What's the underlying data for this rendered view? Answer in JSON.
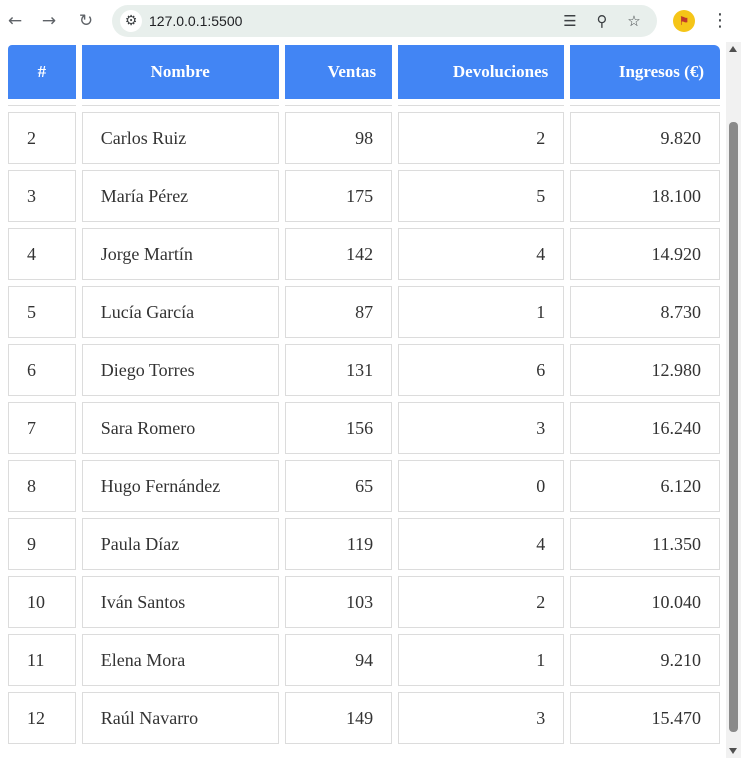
{
  "browser": {
    "url": "127.0.0.1:5500",
    "icons": {
      "back": "arrow-left-icon",
      "forward": "arrow-right-icon",
      "reload": "reload-icon",
      "site_info": "tune-icon",
      "translate": "translate-icon",
      "zoom": "zoom-icon",
      "bookmark": "star-icon",
      "extension": "extension-icon",
      "menu": "kebab-menu-icon"
    }
  },
  "table": {
    "header_color": "#4285f4",
    "columns": [
      "#",
      "Nombre",
      "Ventas",
      "Devoluciones",
      "Ingresos (€)"
    ],
    "rows": [
      {
        "num": "2",
        "name": "Carlos Ruiz",
        "ventas": "98",
        "devoluciones": "2",
        "ingresos": "9.820"
      },
      {
        "num": "3",
        "name": "María Pérez",
        "ventas": "175",
        "devoluciones": "5",
        "ingresos": "18.100"
      },
      {
        "num": "4",
        "name": "Jorge Martín",
        "ventas": "142",
        "devoluciones": "4",
        "ingresos": "14.920"
      },
      {
        "num": "5",
        "name": "Lucía García",
        "ventas": "87",
        "devoluciones": "1",
        "ingresos": "8.730"
      },
      {
        "num": "6",
        "name": "Diego Torres",
        "ventas": "131",
        "devoluciones": "6",
        "ingresos": "12.980"
      },
      {
        "num": "7",
        "name": "Sara Romero",
        "ventas": "156",
        "devoluciones": "3",
        "ingresos": "16.240"
      },
      {
        "num": "8",
        "name": "Hugo Fernández",
        "ventas": "65",
        "devoluciones": "0",
        "ingresos": "6.120"
      },
      {
        "num": "9",
        "name": "Paula Díaz",
        "ventas": "119",
        "devoluciones": "4",
        "ingresos": "11.350"
      },
      {
        "num": "10",
        "name": "Iván Santos",
        "ventas": "103",
        "devoluciones": "2",
        "ingresos": "10.040"
      },
      {
        "num": "11",
        "name": "Elena Mora",
        "ventas": "94",
        "devoluciones": "1",
        "ingresos": "9.210"
      },
      {
        "num": "12",
        "name": "Raúl Navarro",
        "ventas": "149",
        "devoluciones": "3",
        "ingresos": "15.470"
      }
    ]
  }
}
